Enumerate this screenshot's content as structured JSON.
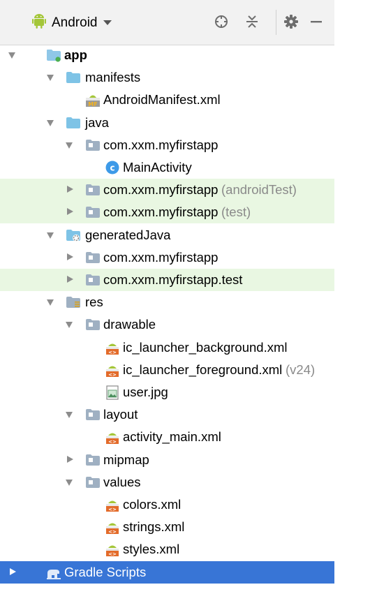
{
  "toolbar": {
    "view_label": "Android"
  },
  "tree": [
    {
      "label": "app",
      "suffix": "",
      "expanded": true,
      "bold": true,
      "icon": "app-module-icon",
      "depth": 0
    },
    {
      "label": "manifests",
      "suffix": "",
      "expanded": true,
      "icon": "folder-icon",
      "depth": 1
    },
    {
      "label": "AndroidManifest.xml",
      "suffix": "",
      "leaf": true,
      "icon": "manifest-file-icon",
      "depth": 2
    },
    {
      "label": "java",
      "suffix": "",
      "expanded": true,
      "icon": "folder-icon",
      "depth": 1
    },
    {
      "label": "com.xxm.myfirstapp",
      "suffix": "",
      "expanded": true,
      "icon": "package-icon",
      "depth": 2
    },
    {
      "label": "MainActivity",
      "suffix": "",
      "leaf": true,
      "icon": "class-icon",
      "depth": 3
    },
    {
      "label": "com.xxm.myfirstapp",
      "suffix": "(androidTest)",
      "expanded": false,
      "highlight": true,
      "icon": "package-icon",
      "depth": 2
    },
    {
      "label": "com.xxm.myfirstapp",
      "suffix": "(test)",
      "expanded": false,
      "highlight": true,
      "icon": "package-icon",
      "depth": 2
    },
    {
      "label": "generatedJava",
      "suffix": "",
      "expanded": true,
      "icon": "generated-folder-icon",
      "depth": 1
    },
    {
      "label": "com.xxm.myfirstapp",
      "suffix": "",
      "expanded": false,
      "icon": "package-icon",
      "depth": 2
    },
    {
      "label": "com.xxm.myfirstapp.test",
      "suffix": "",
      "expanded": false,
      "highlight": true,
      "icon": "package-icon",
      "depth": 2
    },
    {
      "label": "res",
      "suffix": "",
      "expanded": true,
      "icon": "resource-folder-icon",
      "depth": 1
    },
    {
      "label": "drawable",
      "suffix": "",
      "expanded": true,
      "icon": "package-icon",
      "depth": 2
    },
    {
      "label": "ic_launcher_background.xml",
      "suffix": "",
      "leaf": true,
      "icon": "xml-file-icon",
      "depth": 3
    },
    {
      "label": "ic_launcher_foreground.xml",
      "suffix": "(v24)",
      "leaf": true,
      "icon": "xml-file-icon",
      "depth": 3
    },
    {
      "label": "user.jpg",
      "suffix": "",
      "leaf": true,
      "icon": "image-file-icon",
      "depth": 3
    },
    {
      "label": "layout",
      "suffix": "",
      "expanded": true,
      "icon": "package-icon",
      "depth": 2
    },
    {
      "label": "activity_main.xml",
      "suffix": "",
      "leaf": true,
      "icon": "xml-file-icon",
      "depth": 3
    },
    {
      "label": "mipmap",
      "suffix": "",
      "expanded": false,
      "icon": "package-icon",
      "depth": 2
    },
    {
      "label": "values",
      "suffix": "",
      "expanded": true,
      "icon": "package-icon",
      "depth": 2
    },
    {
      "label": "colors.xml",
      "suffix": "",
      "leaf": true,
      "icon": "xml-file-icon",
      "depth": 3
    },
    {
      "label": "strings.xml",
      "suffix": "",
      "leaf": true,
      "icon": "xml-file-icon",
      "depth": 3
    },
    {
      "label": "styles.xml",
      "suffix": "",
      "leaf": true,
      "icon": "xml-file-icon",
      "depth": 3
    },
    {
      "label": "Gradle Scripts",
      "suffix": "",
      "expanded": false,
      "selected": true,
      "icon": "gradle-icon",
      "depth": 0
    }
  ],
  "colors": {
    "highlight": "#e9f7e2",
    "selected": "#3875d6",
    "folder": "#7ec3e6",
    "android": "#a4c639"
  }
}
